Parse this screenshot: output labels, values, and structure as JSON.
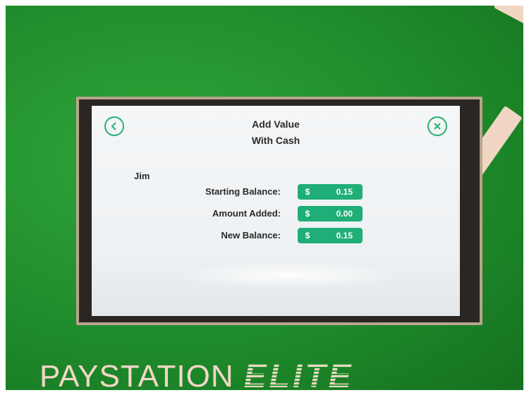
{
  "screen": {
    "title_line1": "Add Value",
    "title_line2": "With Cash",
    "user_name": "Jim",
    "rows": [
      {
        "label": "Starting Balance:",
        "currency": "$",
        "value": "0.15"
      },
      {
        "label": "Amount Added:",
        "currency": "$",
        "value": "0.00"
      },
      {
        "label": "New Balance:",
        "currency": "$",
        "value": "0.15"
      }
    ],
    "icons": {
      "back": "chevron-left-circle-icon",
      "close": "close-circle-icon"
    }
  },
  "branding": {
    "name": "PAYSTATION",
    "tier": "ELITE"
  },
  "colors": {
    "kiosk_green": "#1f8c2b",
    "accent_teal": "#1fae78",
    "brand_peach": "#f2d7c6"
  }
}
